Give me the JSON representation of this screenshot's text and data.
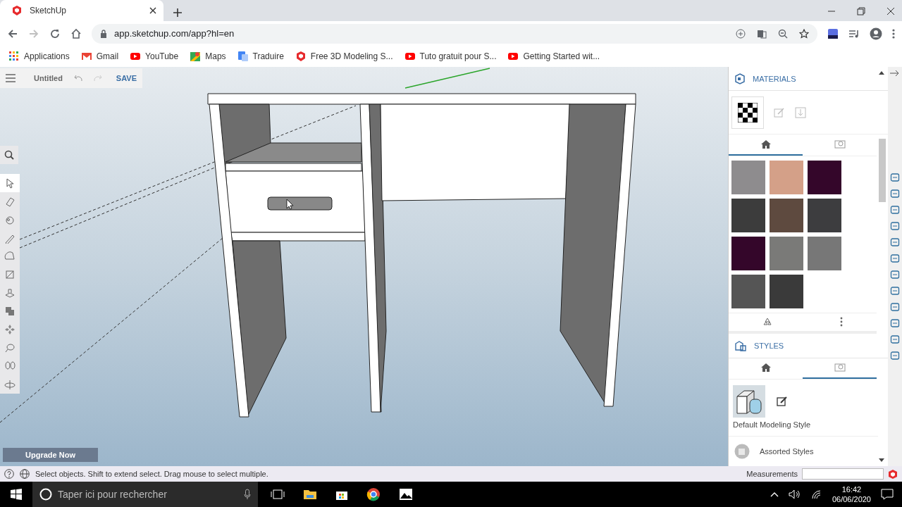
{
  "browser": {
    "tab": {
      "title": "SketchUp"
    },
    "url": "app.sketchup.com/app?hl=en",
    "bookmarks": [
      {
        "kind": "apps",
        "label": "Applications"
      },
      {
        "kind": "gmail",
        "label": "Gmail"
      },
      {
        "kind": "youtube",
        "label": "YouTube"
      },
      {
        "kind": "maps",
        "label": "Maps"
      },
      {
        "kind": "translate",
        "label": "Traduire"
      },
      {
        "kind": "sketchup",
        "label": "Free 3D Modeling S..."
      },
      {
        "kind": "youtube",
        "label": "Tuto gratuit pour S..."
      },
      {
        "kind": "youtube",
        "label": "Getting Started wit..."
      }
    ]
  },
  "toolbar": {
    "title": "Untitled",
    "save": "SAVE"
  },
  "tools": [
    {
      "selected": true
    },
    {
      "selected": false
    },
    {
      "selected": false
    },
    {
      "selected": false
    },
    {
      "selected": false
    },
    {
      "selected": false
    },
    {
      "selected": false
    },
    {
      "selected": false
    },
    {
      "selected": false
    },
    {
      "selected": false
    },
    {
      "selected": false
    },
    {
      "selected": false
    }
  ],
  "viewport": {
    "upgrade": "Upgrade Now"
  },
  "materials": {
    "title": "MATERIALS",
    "tabs": [
      {
        "selected": true
      },
      {
        "selected": false
      }
    ],
    "swatches": [
      {
        "color": "#8e8c8e"
      },
      {
        "color": "#d4a088"
      },
      {
        "color": "#34062a"
      },
      {
        "color": "#3c3c3c"
      },
      {
        "color": "#5e4a3f"
      },
      {
        "color": "#3d3d3f"
      },
      {
        "color": "#34062a"
      },
      {
        "color": "#7a7a78"
      },
      {
        "color": "#777777"
      },
      {
        "color": "#555555"
      },
      {
        "color": "#3a3a3a"
      }
    ]
  },
  "styles": {
    "title": "STYLES",
    "tabs": [
      {
        "selected": false
      },
      {
        "selected": true
      }
    ],
    "current": "Default Modeling Style",
    "collection": "Assorted Styles"
  },
  "status_bar": {
    "message": "Select objects. Shift to extend select. Drag mouse to select multiple.",
    "measurements_label": "Measurements"
  },
  "taskbar": {
    "search_placeholder": "Taper ici pour rechercher",
    "time": "16:42",
    "date": "06/06/2020"
  }
}
